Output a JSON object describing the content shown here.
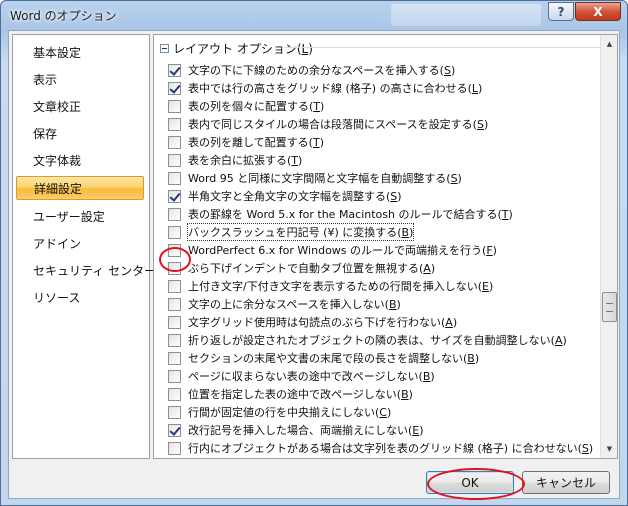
{
  "window": {
    "title": "Word のオプション"
  },
  "title_controls": {
    "help": "?",
    "close": "X"
  },
  "nav": {
    "items": [
      "基本設定",
      "表示",
      "文章校正",
      "保存",
      "文字体裁",
      "詳細設定",
      "ユーザー設定",
      "アドイン",
      "セキュリティ センター",
      "リソース"
    ],
    "active_index": 5
  },
  "section": {
    "title_main": "レイアウト オプション(",
    "title_key": "L",
    "title_end": ")"
  },
  "options": [
    {
      "text": "文字の下に下線のための余分なスペースを挿入する(",
      "key": "S",
      "end": ")",
      "checked": true
    },
    {
      "text": "表中では行の高さをグリッド線 (格子) の高さに合わせる(",
      "key": "L",
      "end": ")",
      "checked": true
    },
    {
      "text": "表の列を個々に配置する(",
      "key": "T",
      "end": ")",
      "checked": false
    },
    {
      "text": "表内で同じスタイルの場合は段落間にスペースを設定する(",
      "key": "S",
      "end": ")",
      "checked": false
    },
    {
      "text": "表の列を離して配置する(",
      "key": "T",
      "end": ")",
      "checked": false
    },
    {
      "text": "表を余白に拡張する(",
      "key": "T",
      "end": ")",
      "checked": false
    },
    {
      "text": "Word 95 と同様に文字間隔と文字幅を自動調整する(",
      "key": "S",
      "end": ")",
      "checked": false
    },
    {
      "text": "半角文字と全角文字の文字幅を調整する(",
      "key": "S",
      "end": ")",
      "checked": true
    },
    {
      "text": "表の罫線を Word 5.x for the Macintosh のルールで結合する(",
      "key": "T",
      "end": ")",
      "checked": false
    },
    {
      "text": "バックスラッシュを円記号 (¥) に変換する(",
      "key": "B",
      "end": ")",
      "checked": false,
      "focused": true
    },
    {
      "text": "WordPerfect 6.x for Windows のルールで両端揃えを行う(",
      "key": "F",
      "end": ")",
      "checked": false
    },
    {
      "text": "ぶら下げインデントで自動タブ位置を無視する(",
      "key": "A",
      "end": ")",
      "checked": false
    },
    {
      "text": "上付き文字/下付き文字を表示するための行間を挿入しない(",
      "key": "E",
      "end": ")",
      "checked": false
    },
    {
      "text": "文字の上に余分なスペースを挿入しない(",
      "key": "B",
      "end": ")",
      "checked": false
    },
    {
      "text": "文字グリッド使用時は句読点のぶら下げを行わない(",
      "key": "A",
      "end": ")",
      "checked": false
    },
    {
      "text": "折り返しが設定されたオブジェクトの隣の表は、サイズを自動調整しない(",
      "key": "A",
      "end": ")",
      "checked": false
    },
    {
      "text": "セクションの末尾や文書の末尾で段の長さを調整しない(",
      "key": "B",
      "end": ")",
      "checked": false
    },
    {
      "text": "ページに収まらない表の途中で改ページしない(",
      "key": "B",
      "end": ")",
      "checked": false
    },
    {
      "text": "位置を指定した表の途中で改ページしない(",
      "key": "B",
      "end": ")",
      "checked": false
    },
    {
      "text": "行間が固定値の行を中央揃えにしない(",
      "key": "C",
      "end": ")",
      "checked": false
    },
    {
      "text": "改行記号を挿入した場合、両端揃えにしない(",
      "key": "E",
      "end": ")",
      "checked": true
    },
    {
      "text": "行内にオブジェクトがある場合は文字列を表のグリッド線 (格子) に合わせない(",
      "key": "S",
      "end": ")",
      "checked": false
    }
  ],
  "buttons": {
    "ok": "OK",
    "cancel": "キャンセル"
  },
  "colors": {
    "annotation_red": "#e0101e",
    "nav_active": "#fbd472"
  }
}
